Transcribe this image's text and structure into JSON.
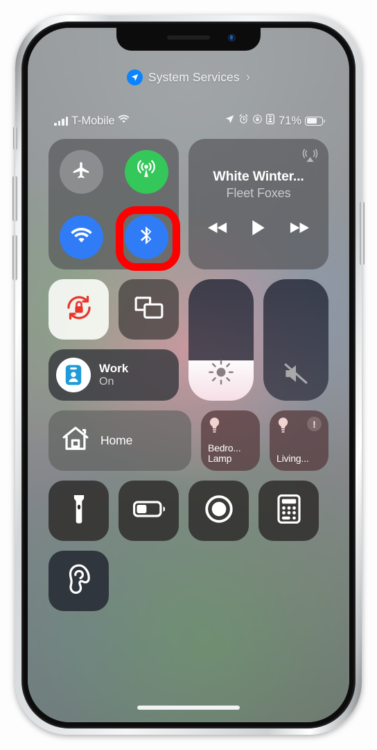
{
  "banner": {
    "icon": "location-arrow-icon",
    "label": "System Services",
    "chevron": "›",
    "accent": "#0a84ff"
  },
  "status_bar": {
    "signal_icon": "cellular-bars-icon",
    "carrier": "T-Mobile",
    "wifi_icon": "wifi-icon",
    "location_icon": "location-arrow-icon",
    "alarm_icon": "alarm-clock-icon",
    "rotation_lock_icon": "rotation-lock-icon",
    "focus_icon": "focus-badge-icon",
    "battery_percent": "71%",
    "battery_icon": "battery-icon",
    "battery_level": 71
  },
  "connectivity": {
    "airplane": {
      "name": "Airplane Mode",
      "icon": "airplane-icon",
      "state": "off",
      "color": "#919294"
    },
    "cellular": {
      "name": "Cellular Data",
      "icon": "cellular-antenna-icon",
      "state": "on",
      "color": "#34c759"
    },
    "wifi": {
      "name": "Wi-Fi",
      "icon": "wifi-icon",
      "state": "on",
      "color": "#2f7cf6"
    },
    "bluetooth": {
      "name": "Bluetooth",
      "icon": "bluetooth-icon",
      "state": "on",
      "color": "#2f7cf6",
      "highlighted": true
    },
    "highlight_color": "#fe0000"
  },
  "music": {
    "airplay_icon": "airplay-audio-icon",
    "title": "White Winter...",
    "artist": "Fleet Foxes",
    "rewind_icon": "rewind-icon",
    "play_icon": "play-icon",
    "forward_icon": "fast-forward-icon",
    "playing": false
  },
  "toggles": {
    "rotation_lock": {
      "name": "Rotation Lock",
      "icon": "rotation-lock-icon",
      "state": "on",
      "color": "#ff3b30"
    },
    "screen_mirroring": {
      "name": "Screen Mirroring",
      "icon": "screen-mirroring-icon",
      "state": "off"
    }
  },
  "focus": {
    "icon": "focus-work-badge-icon",
    "name": "Work",
    "state": "On",
    "icon_color": "#1f9bd8"
  },
  "sliders": {
    "brightness": {
      "name": "Brightness",
      "icon": "brightness-sun-icon",
      "value": 33
    },
    "volume": {
      "name": "Volume",
      "icon": "volume-mute-icon",
      "value": 0,
      "muted": true
    }
  },
  "home": {
    "button": {
      "icon": "home-house-icon",
      "label": "Home"
    },
    "tiles": [
      {
        "icon": "lightbulb-icon",
        "label": "Bedro...\nLamp",
        "line1": "Bedro...",
        "line2": "Lamp",
        "warning": false
      },
      {
        "icon": "lightbulb-icon",
        "label": "Living...",
        "line1": "Living...",
        "line2": "",
        "warning": true,
        "warning_icon": "exclamation-badge-icon"
      }
    ]
  },
  "utilities": [
    {
      "name": "Flashlight",
      "icon": "flashlight-icon"
    },
    {
      "name": "Low Power Mode",
      "icon": "low-power-battery-icon"
    },
    {
      "name": "Screen Recording",
      "icon": "screen-record-icon"
    },
    {
      "name": "Calculator",
      "icon": "calculator-icon"
    },
    {
      "name": "Hearing",
      "icon": "hearing-ear-icon"
    }
  ],
  "home_indicator": "home-indicator-bar"
}
